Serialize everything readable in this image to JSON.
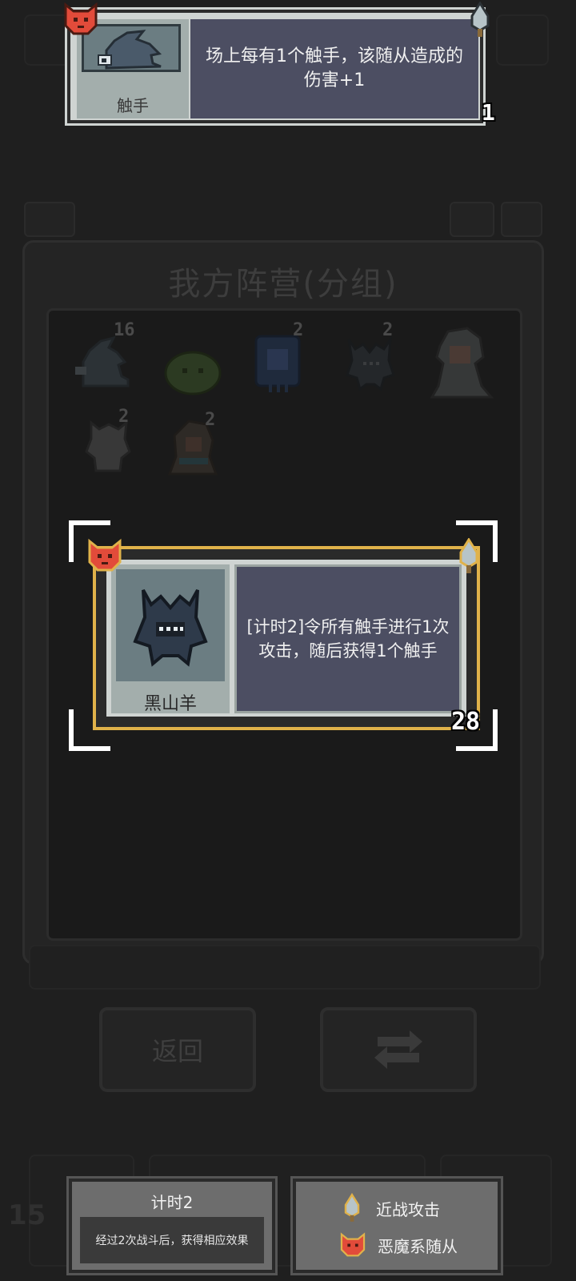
{
  "tooltip_card": {
    "name": "触手",
    "description": "场上每有1个触手，该随从造成的伤害+1",
    "stat": "1",
    "icons": [
      "demon-badge-icon",
      "melee-badge-icon",
      "tentacle-icon"
    ]
  },
  "roster_panel": {
    "title": "我方阵营(分组)",
    "units": [
      {
        "icon": "tentacle-icon",
        "count": "16"
      },
      {
        "icon": "green-slime-icon",
        "count": ""
      },
      {
        "icon": "blue-totem-icon",
        "count": "2"
      },
      {
        "icon": "black-goat-icon",
        "count": "2"
      },
      {
        "icon": "white-haired-hero-icon",
        "count": ""
      },
      {
        "icon": "white-imp-icon",
        "count": "2"
      },
      {
        "icon": "hooded-mage-icon",
        "count": "2"
      }
    ]
  },
  "selected_card": {
    "name": "黑山羊",
    "description": "[计时2]令所有触手进行1次攻击，随后获得1个触手",
    "stat": "28",
    "icons": [
      "demon-badge-icon",
      "melee-badge-icon",
      "black-goat-icon"
    ]
  },
  "buttons": {
    "back_label": "返回",
    "swap_icon": "swap-arrows-icon"
  },
  "corner_number": "15",
  "keyword_panel": {
    "title": "计时2",
    "body": "经过2次战斗后，获得相应效果"
  },
  "legend_panel": {
    "items": [
      {
        "icon": "melee-badge-icon",
        "label": "近战攻击"
      },
      {
        "icon": "demon-badge-icon",
        "label": "恶魔系随从"
      }
    ]
  },
  "colors": {
    "background": "#1f1f1f",
    "card_face": "#cfd4d2",
    "description_box": "#4c4e62",
    "selection_gold": "#e0b24a",
    "demon_red": "#e24b3a",
    "info_grey": "#6d6d6d"
  }
}
